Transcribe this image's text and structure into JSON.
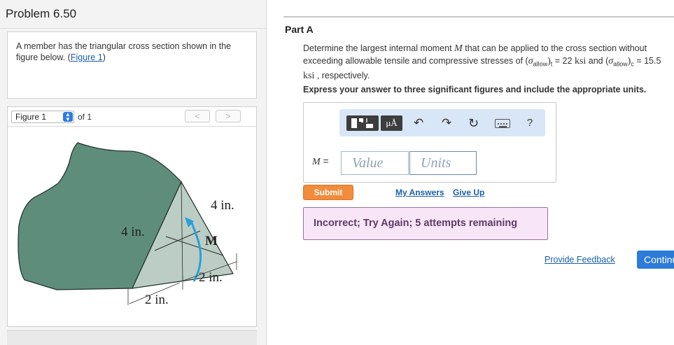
{
  "problem": {
    "title": "Problem 6.50",
    "intro_text": "A member has the triangular cross section shown in the figure below. (",
    "intro_link": "Figure 1",
    "intro_close": ")"
  },
  "figure_panel": {
    "selected": "Figure 1",
    "of_label": "of 1",
    "prev_label": "<",
    "next_label": ">",
    "dims": {
      "left_side": "4 in.",
      "right_side": "4 in.",
      "bottom_left": "2 in.",
      "bottom_right": "2 in.",
      "moment": "M"
    },
    "colors": {
      "beam": "#5e8d7c",
      "section": "#bccdc5",
      "moment_arrow": "#2b9fd9"
    }
  },
  "part": {
    "title": "Part A",
    "question_1": "Determine the largest internal moment ",
    "question_m": "M",
    "question_2": " that can be applied to the cross section without exceeding allowable tensile and compressive stresses of (",
    "sigma": "σ",
    "allow": "allow",
    "sub_t": "t",
    "question_3": " = 22 ",
    "ksi": "ksi",
    "question_4": " and (",
    "sub_c": "c",
    "question_5": " = 15.5 ",
    "question_6": " , respectively.",
    "instruction": "Express your answer to three significant figures and include the appropriate units."
  },
  "toolbar": {
    "units_label": "μÅ",
    "undo_icon": "undo-icon",
    "redo_icon": "redo-icon",
    "reset_icon": "reset-icon",
    "keyboard_icon": "keyboard-icon",
    "help_label": "?"
  },
  "answer": {
    "variable_label": "M =",
    "value_placeholder": "Value",
    "units_placeholder": "Units"
  },
  "actions": {
    "submit_label": "Submit",
    "my_answers_label": "My Answers",
    "give_up_label": "Give Up"
  },
  "feedback": {
    "message": "Incorrect; Try Again; 5 attempts remaining"
  },
  "footer": {
    "provide_feedback_label": "Provide Feedback",
    "continue_label": "Continue"
  }
}
